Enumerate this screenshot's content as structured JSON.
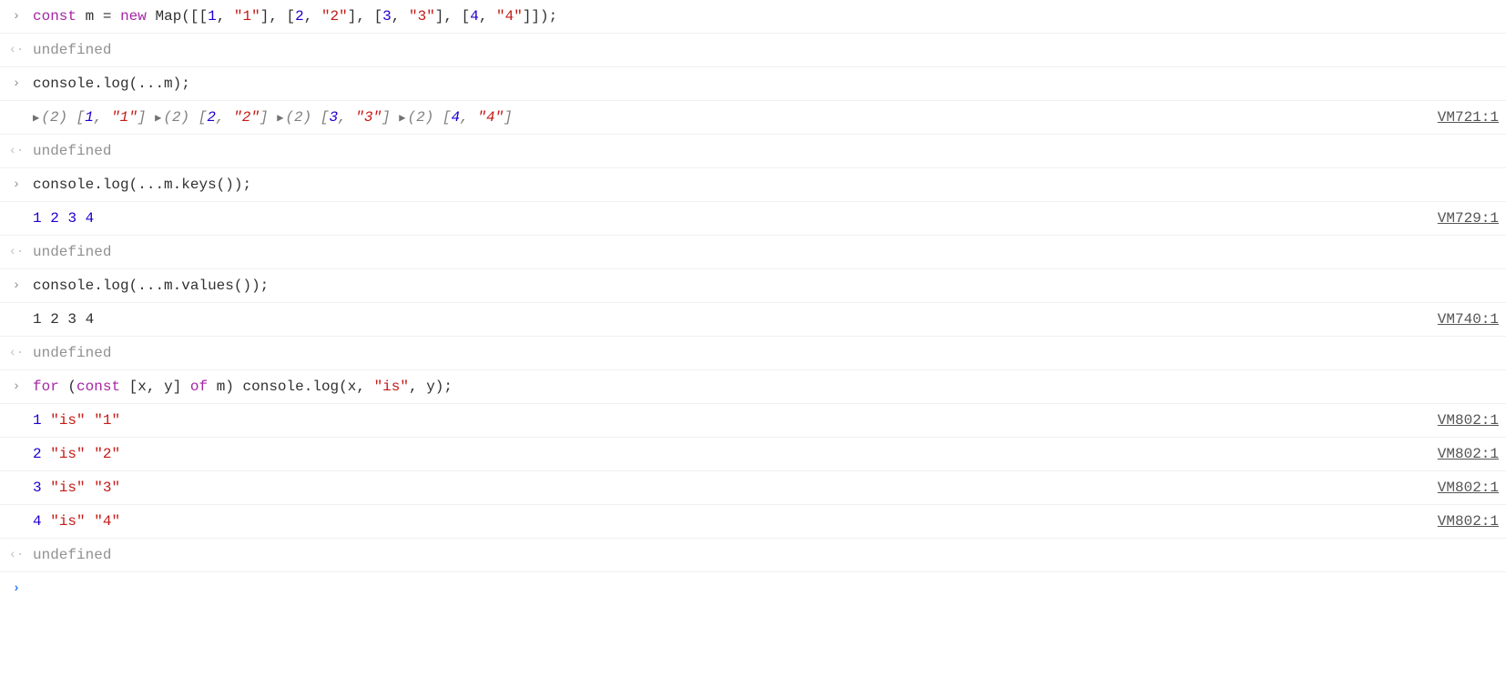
{
  "rows": [
    {
      "type": "input",
      "tokens": [
        {
          "t": "keyword",
          "v": "const"
        },
        {
          "t": "space",
          "v": " "
        },
        {
          "t": "ident",
          "v": "m"
        },
        {
          "t": "space",
          "v": " "
        },
        {
          "t": "punct",
          "v": "="
        },
        {
          "t": "space",
          "v": " "
        },
        {
          "t": "keyword",
          "v": "new"
        },
        {
          "t": "space",
          "v": " "
        },
        {
          "t": "ident",
          "v": "Map"
        },
        {
          "t": "punct",
          "v": "([["
        },
        {
          "t": "number",
          "v": "1"
        },
        {
          "t": "punct",
          "v": ", "
        },
        {
          "t": "string",
          "v": "\"1\""
        },
        {
          "t": "punct",
          "v": "], ["
        },
        {
          "t": "number",
          "v": "2"
        },
        {
          "t": "punct",
          "v": ", "
        },
        {
          "t": "string",
          "v": "\"2\""
        },
        {
          "t": "punct",
          "v": "], ["
        },
        {
          "t": "number",
          "v": "3"
        },
        {
          "t": "punct",
          "v": ", "
        },
        {
          "t": "string",
          "v": "\"3\""
        },
        {
          "t": "punct",
          "v": "], ["
        },
        {
          "t": "number",
          "v": "4"
        },
        {
          "t": "punct",
          "v": ", "
        },
        {
          "t": "string",
          "v": "\"4\""
        },
        {
          "t": "punct",
          "v": "]]);"
        }
      ]
    },
    {
      "type": "return",
      "text": "undefined"
    },
    {
      "type": "input",
      "tokens": [
        {
          "t": "ident",
          "v": "console"
        },
        {
          "t": "punct",
          "v": "."
        },
        {
          "t": "ident",
          "v": "log"
        },
        {
          "t": "punct",
          "v": "(..."
        },
        {
          "t": "ident",
          "v": "m"
        },
        {
          "t": "punct",
          "v": ");"
        }
      ]
    },
    {
      "type": "log-arrays",
      "source": "VM721:1",
      "items": [
        {
          "len": "(2)",
          "entries": [
            {
              "t": "number",
              "v": "1"
            },
            {
              "t": "string",
              "v": "\"1\""
            }
          ]
        },
        {
          "len": "(2)",
          "entries": [
            {
              "t": "number",
              "v": "2"
            },
            {
              "t": "string",
              "v": "\"2\""
            }
          ]
        },
        {
          "len": "(2)",
          "entries": [
            {
              "t": "number",
              "v": "3"
            },
            {
              "t": "string",
              "v": "\"3\""
            }
          ]
        },
        {
          "len": "(2)",
          "entries": [
            {
              "t": "number",
              "v": "4"
            },
            {
              "t": "string",
              "v": "\"4\""
            }
          ]
        }
      ]
    },
    {
      "type": "return",
      "text": "undefined"
    },
    {
      "type": "input",
      "tokens": [
        {
          "t": "ident",
          "v": "console"
        },
        {
          "t": "punct",
          "v": "."
        },
        {
          "t": "ident",
          "v": "log"
        },
        {
          "t": "punct",
          "v": "(..."
        },
        {
          "t": "ident",
          "v": "m"
        },
        {
          "t": "punct",
          "v": "."
        },
        {
          "t": "ident",
          "v": "keys"
        },
        {
          "t": "punct",
          "v": "());"
        }
      ]
    },
    {
      "type": "log-numbers",
      "source": "VM729:1",
      "values": [
        "1",
        "2",
        "3",
        "4"
      ]
    },
    {
      "type": "return",
      "text": "undefined"
    },
    {
      "type": "input",
      "tokens": [
        {
          "t": "ident",
          "v": "console"
        },
        {
          "t": "punct",
          "v": "."
        },
        {
          "t": "ident",
          "v": "log"
        },
        {
          "t": "punct",
          "v": "(..."
        },
        {
          "t": "ident",
          "v": "m"
        },
        {
          "t": "punct",
          "v": "."
        },
        {
          "t": "ident",
          "v": "values"
        },
        {
          "t": "punct",
          "v": "());"
        }
      ]
    },
    {
      "type": "log-plain",
      "source": "VM740:1",
      "text": "1 2 3 4"
    },
    {
      "type": "return",
      "text": "undefined"
    },
    {
      "type": "input",
      "tokens": [
        {
          "t": "keyword",
          "v": "for"
        },
        {
          "t": "space",
          "v": " "
        },
        {
          "t": "punct",
          "v": "("
        },
        {
          "t": "keyword",
          "v": "const"
        },
        {
          "t": "space",
          "v": " "
        },
        {
          "t": "punct",
          "v": "["
        },
        {
          "t": "ident",
          "v": "x"
        },
        {
          "t": "punct",
          "v": ", "
        },
        {
          "t": "ident",
          "v": "y"
        },
        {
          "t": "punct",
          "v": "] "
        },
        {
          "t": "keyword",
          "v": "of"
        },
        {
          "t": "space",
          "v": " "
        },
        {
          "t": "ident",
          "v": "m"
        },
        {
          "t": "punct",
          "v": ") "
        },
        {
          "t": "ident",
          "v": "console"
        },
        {
          "t": "punct",
          "v": "."
        },
        {
          "t": "ident",
          "v": "log"
        },
        {
          "t": "punct",
          "v": "("
        },
        {
          "t": "ident",
          "v": "x"
        },
        {
          "t": "punct",
          "v": ", "
        },
        {
          "t": "string",
          "v": "\"is\""
        },
        {
          "t": "punct",
          "v": ", "
        },
        {
          "t": "ident",
          "v": "y"
        },
        {
          "t": "punct",
          "v": ");"
        }
      ]
    },
    {
      "type": "log-isline",
      "source": "VM802:1",
      "num": "1",
      "s1": "\"is\"",
      "s2": "\"1\""
    },
    {
      "type": "log-isline",
      "source": "VM802:1",
      "num": "2",
      "s1": "\"is\"",
      "s2": "\"2\""
    },
    {
      "type": "log-isline",
      "source": "VM802:1",
      "num": "3",
      "s1": "\"is\"",
      "s2": "\"3\""
    },
    {
      "type": "log-isline",
      "source": "VM802:1",
      "num": "4",
      "s1": "\"is\"",
      "s2": "\"4\""
    },
    {
      "type": "return",
      "text": "undefined"
    },
    {
      "type": "prompt"
    }
  ],
  "glyphs": {
    "input": "›",
    "output": "‹·",
    "expand": "▶",
    "prompt": "›"
  }
}
